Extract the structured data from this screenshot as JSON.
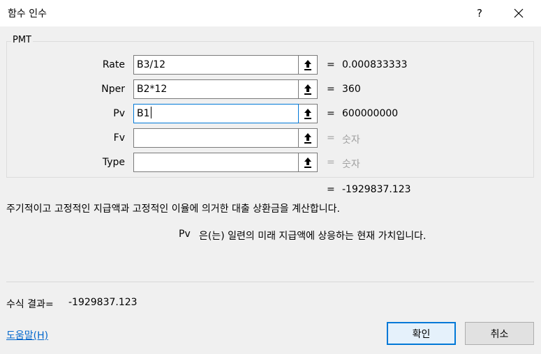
{
  "window": {
    "title": "함수 인수",
    "help_glyph": "?"
  },
  "function_name": "PMT",
  "arguments": [
    {
      "label": "Rate",
      "value": "B3/12",
      "result": "0.000833333",
      "hint": false
    },
    {
      "label": "Nper",
      "value": "B2*12",
      "result": "360",
      "hint": false
    },
    {
      "label": "Pv",
      "value": "B1",
      "result": "600000000",
      "hint": false
    },
    {
      "label": "Fv",
      "value": "",
      "result": "숫자",
      "hint": true
    },
    {
      "label": "Type",
      "value": "",
      "result": "숫자",
      "hint": true
    }
  ],
  "equals": "=",
  "function_result": "-1929837.123",
  "function_description": "주기적이고 고정적인 지급액과 고정적인 이율에 의거한 대출 상환금을 계산합니다.",
  "argument_description": {
    "name": "Pv",
    "text": "은(는) 일련의 미래 지급액에 상응하는 현재 가치입니다."
  },
  "formula_result": {
    "label": "수식 결과=",
    "value": "-1929837.123"
  },
  "help_link": "도움말(H)",
  "buttons": {
    "ok": "확인",
    "cancel": "취소"
  }
}
